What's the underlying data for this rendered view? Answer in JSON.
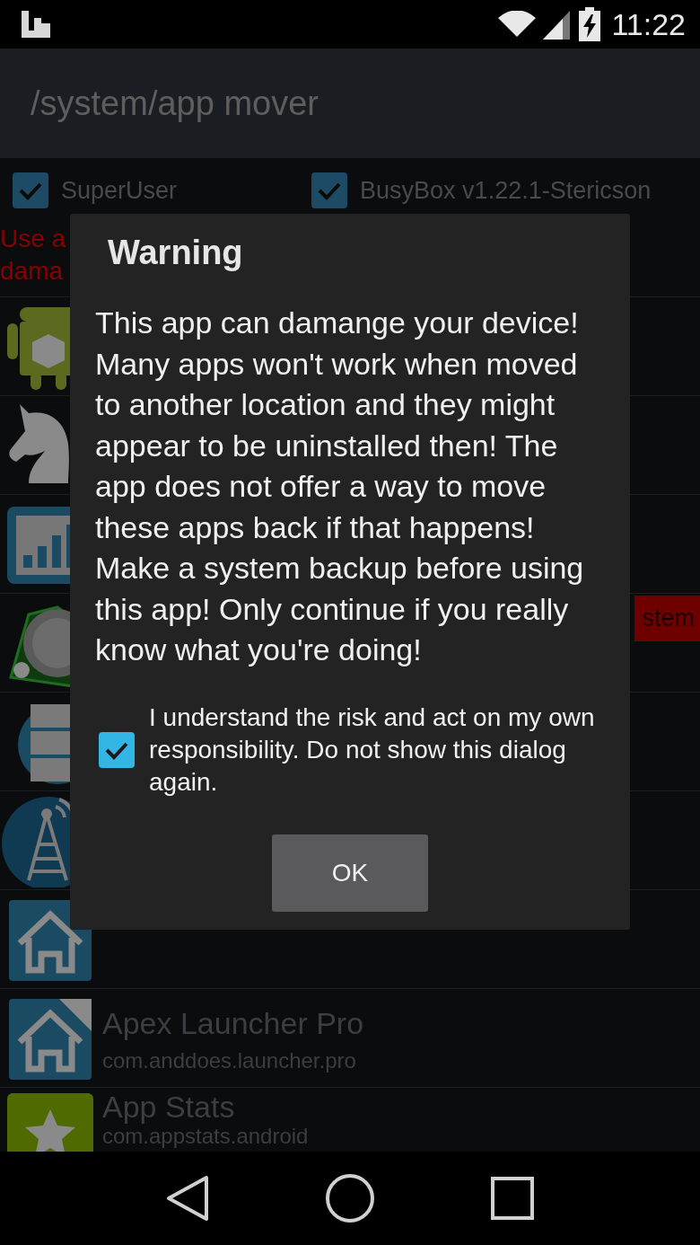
{
  "status_bar": {
    "time": "11:22"
  },
  "app_bar": {
    "title": "/system/app mover"
  },
  "filters": [
    {
      "label": "SuperUser",
      "checked": true
    },
    {
      "label": "BusyBox v1.22.1-Stericson",
      "checked": true
    }
  ],
  "notice_lines": [
    "Use a",
    "dama"
  ],
  "apps": [
    {
      "kind": "android"
    },
    {
      "kind": "knight"
    },
    {
      "kind": "chart"
    },
    {
      "kind": "knob",
      "badge": "stem"
    },
    {
      "kind": "blocks"
    },
    {
      "kind": "tower"
    },
    {
      "kind": "home"
    },
    {
      "kind": "homepro",
      "name": "Apex Launcher Pro",
      "package": "com.anddoes.launcher.pro"
    },
    {
      "kind": "star",
      "name": "App Stats",
      "package": "com.appstats.android"
    }
  ],
  "dialog": {
    "title": "Warning",
    "message": "This app can damange your device! Many apps won't work when moved to another location and they might appear to be uninstalled then! The app does not offer a way to move these apps back if that happens! Make a system backup before using this app! Only continue if you really know what you're doing!",
    "checkbox": {
      "label": "I understand the risk and act on my own responsibility. Do not show this dialog again.",
      "checked": true
    },
    "buttons": [
      "OK"
    ]
  }
}
